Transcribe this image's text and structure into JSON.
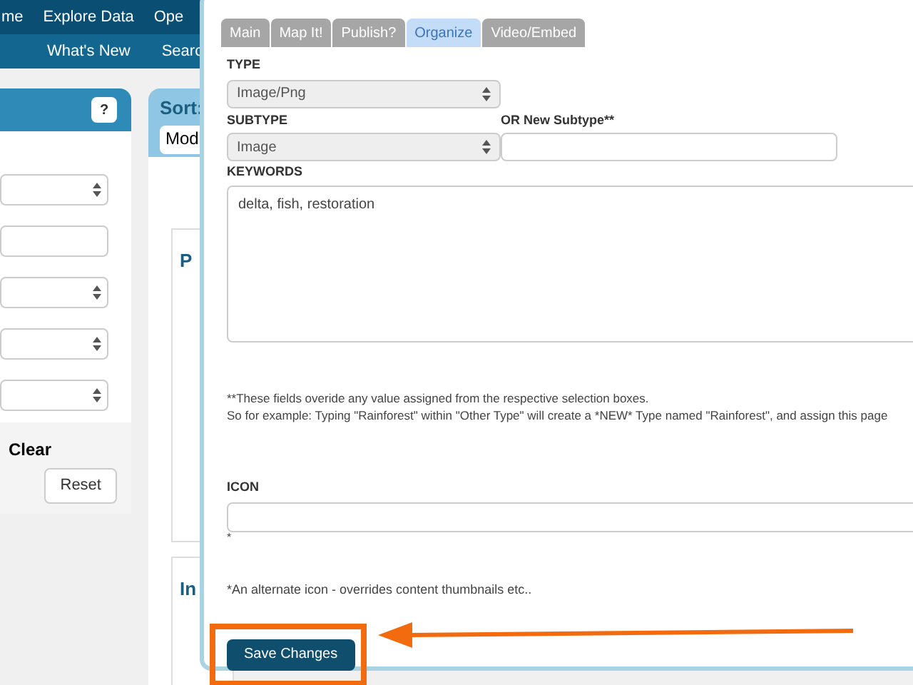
{
  "nav": {
    "primary": [
      "me",
      "Explore Data",
      "Ope"
    ],
    "secondary": [
      "What's New",
      "Searc"
    ]
  },
  "filter_panel": {
    "help_button": "?",
    "clear_label": "Clear",
    "reset_button": "Reset"
  },
  "sort": {
    "label": "Sort:",
    "value": "Mod"
  },
  "cards": [
    "P",
    "In"
  ],
  "modal": {
    "tabs": [
      {
        "label": "Main",
        "selected": false
      },
      {
        "label": "Map It!",
        "selected": false
      },
      {
        "label": "Publish?",
        "selected": false
      },
      {
        "label": "Organize",
        "selected": true
      },
      {
        "label": "Video/Embed",
        "selected": false
      }
    ],
    "type_label": "TYPE",
    "type_value": "Image/Png",
    "subtype_label": "SUBTYPE",
    "subtype_value": "Image",
    "new_subtype_label": "OR New Subtype**",
    "keywords_label": "KEYWORDS",
    "keywords_value": "delta, fish, restoration",
    "note_lines": [
      "**These fields overide any value assigned from the respective selection boxes.",
      "So for example: Typing \"Rainforest\" within \"Other Type\" will create a *NEW* Type named \"Rainforest\", and assign this page"
    ],
    "icon_label": "ICON",
    "icon_mark": "*",
    "icon_note": "*An alternate icon - overrides content thumbnails etc..",
    "save_button": "Save Changes"
  }
}
